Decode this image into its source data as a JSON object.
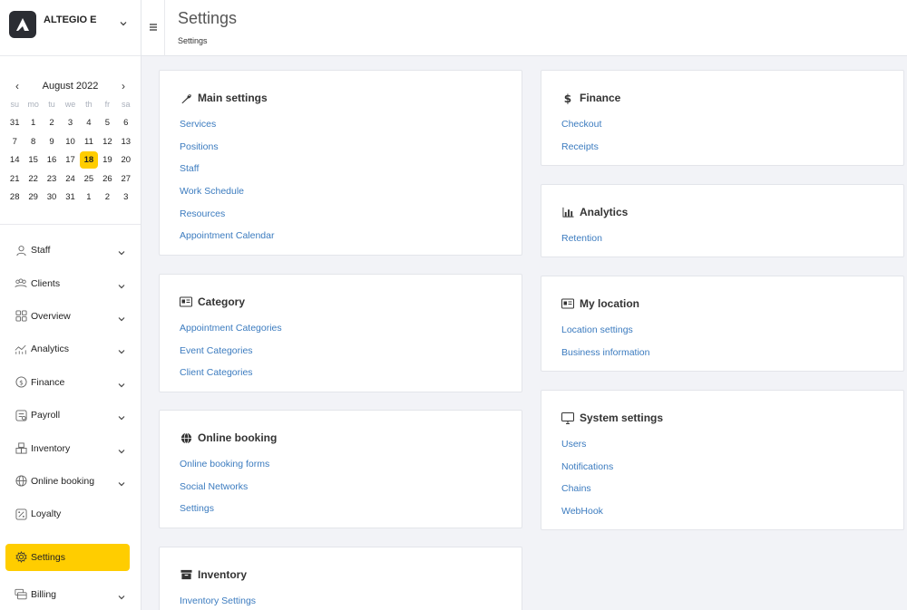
{
  "brand": {
    "name": "ALTEGIO E"
  },
  "calendar": {
    "month": "August 2022",
    "prev": "‹",
    "next": "›",
    "dow": [
      "su",
      "mo",
      "tu",
      "we",
      "th",
      "fr",
      "sa"
    ],
    "weeks": [
      [
        "31",
        "1",
        "2",
        "3",
        "4",
        "5",
        "6"
      ],
      [
        "7",
        "8",
        "9",
        "10",
        "11",
        "12",
        "13"
      ],
      [
        "14",
        "15",
        "16",
        "17",
        "18",
        "19",
        "20"
      ],
      [
        "21",
        "22",
        "23",
        "24",
        "25",
        "26",
        "27"
      ],
      [
        "28",
        "29",
        "30",
        "31",
        "1",
        "2",
        "3"
      ]
    ],
    "today": "18"
  },
  "nav": {
    "items": [
      {
        "label": "Staff",
        "icon": "person-icon",
        "chevron": true
      },
      {
        "label": "Clients",
        "icon": "people-icon",
        "chevron": true
      },
      {
        "label": "Overview",
        "icon": "grid-icon",
        "chevron": true
      },
      {
        "label": "Analytics",
        "icon": "analytics-icon",
        "chevron": true
      },
      {
        "label": "Finance",
        "icon": "dollar-circle-icon",
        "chevron": true
      },
      {
        "label": "Payroll",
        "icon": "payroll-icon",
        "chevron": true
      },
      {
        "label": "Inventory",
        "icon": "inventory-icon",
        "chevron": true
      },
      {
        "label": "Online booking",
        "icon": "globe-icon",
        "chevron": true
      },
      {
        "label": "Loyalty",
        "icon": "percent-icon",
        "chevron": false
      }
    ],
    "settings": "Settings",
    "billing": "Billing"
  },
  "header": {
    "title": "Settings",
    "breadcrumb": "Settings"
  },
  "cards": {
    "main": {
      "title": "Main settings",
      "links": [
        "Services",
        "Positions",
        "Staff",
        "Work Schedule",
        "Resources",
        "Appointment Calendar"
      ]
    },
    "category": {
      "title": "Category",
      "links": [
        "Appointment Categories",
        "Event Categories",
        "Client Categories"
      ]
    },
    "booking": {
      "title": "Online booking",
      "links": [
        "Online booking forms",
        "Social Networks",
        "Settings"
      ]
    },
    "inventory": {
      "title": "Inventory",
      "links": [
        "Inventory Settings"
      ]
    },
    "finance": {
      "title": "Finance",
      "links": [
        "Checkout",
        "Receipts"
      ]
    },
    "analytics": {
      "title": "Analytics",
      "links": [
        "Retention"
      ]
    },
    "location": {
      "title": "My location",
      "links": [
        "Location settings",
        "Business information"
      ]
    },
    "system": {
      "title": "System settings",
      "links": [
        "Users",
        "Notifications",
        "Chains",
        "WebHook"
      ]
    }
  },
  "colors": {
    "accent": "#ffcd00",
    "link": "#3b7bbf"
  }
}
